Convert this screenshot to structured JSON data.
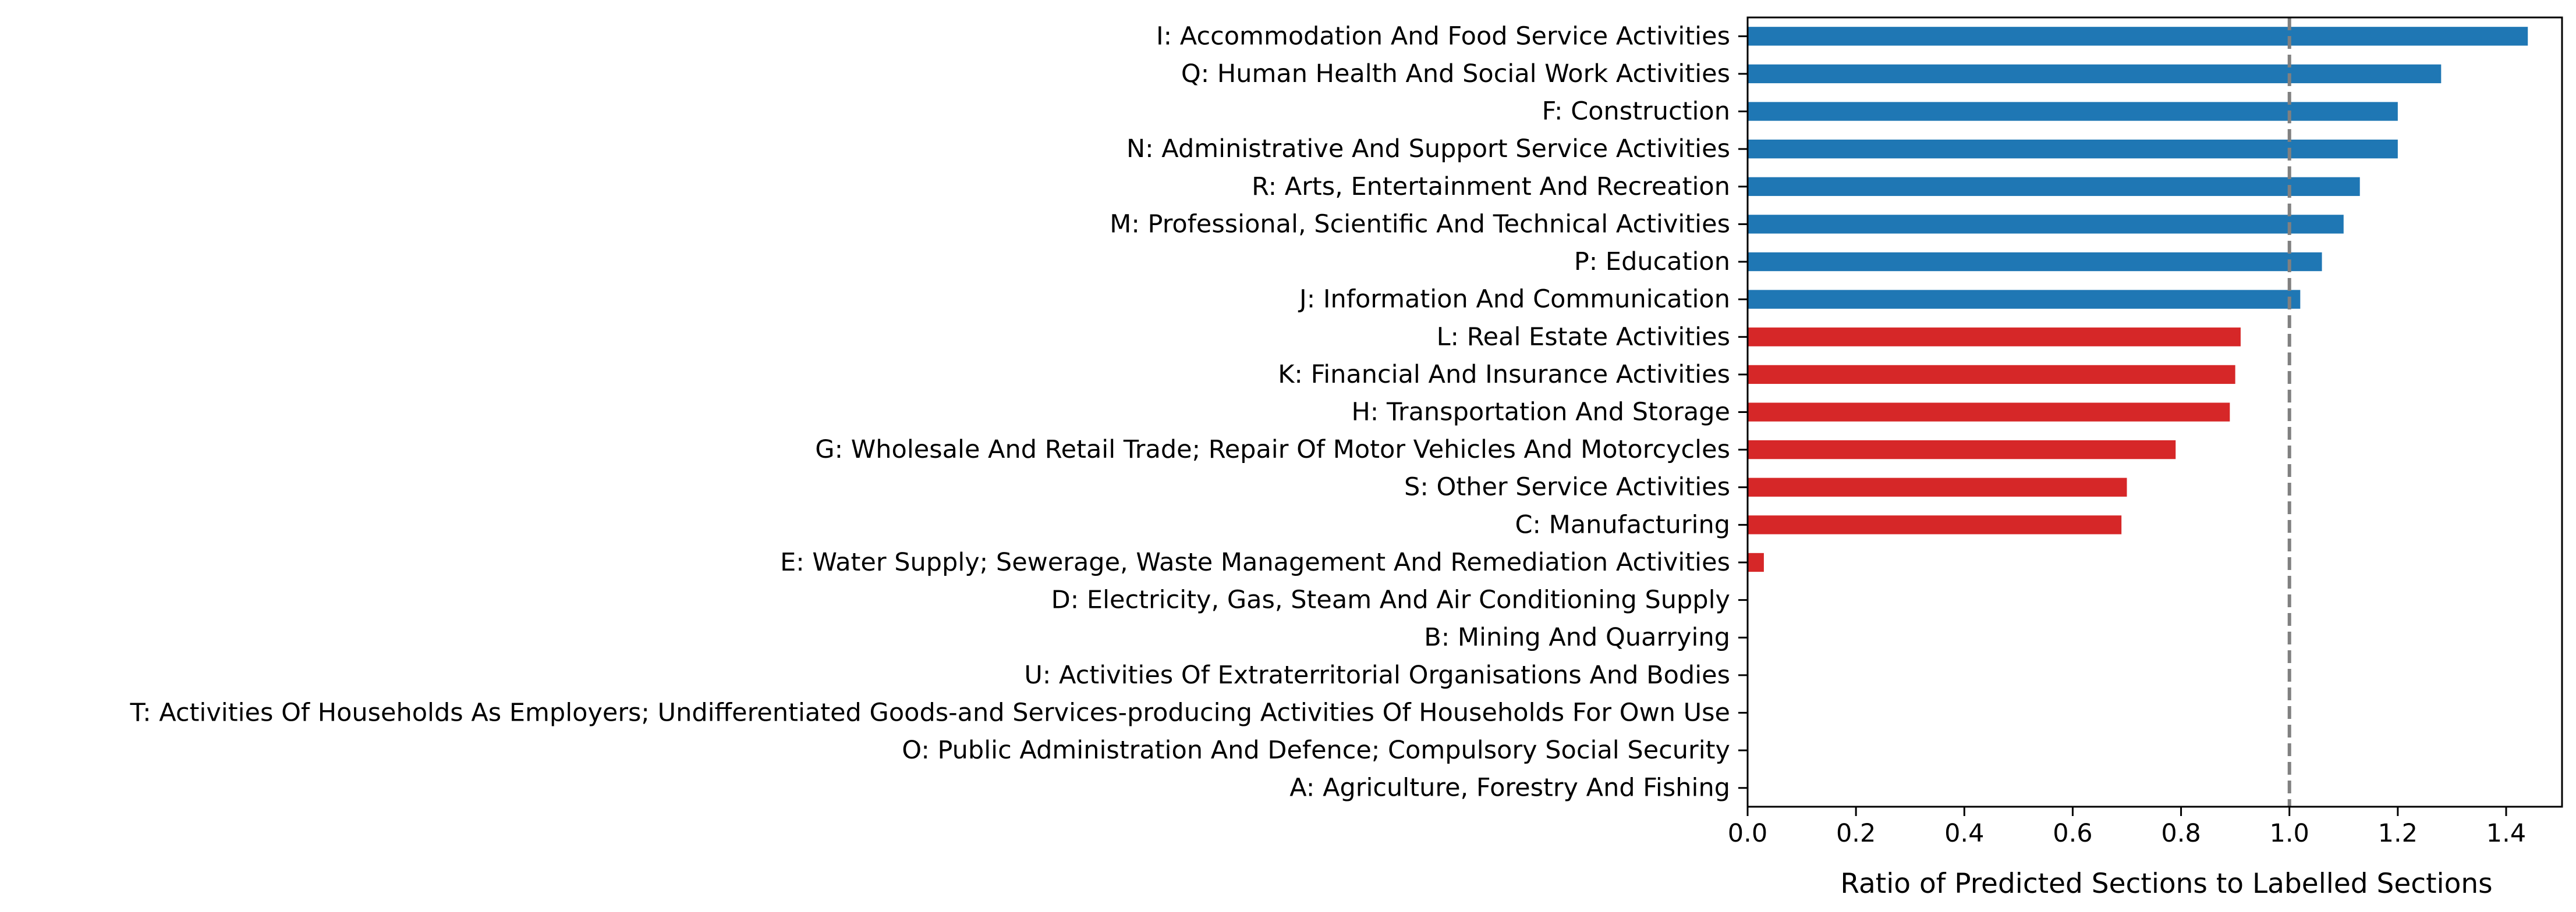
{
  "chart_data": {
    "type": "bar",
    "orientation": "horizontal",
    "title": "",
    "xlabel": "Ratio of Predicted Sections to Labelled Sections",
    "ylabel": "",
    "xlim": [
      0.0,
      1.51
    ],
    "xticks": [
      "0.0",
      "0.2",
      "0.4",
      "0.6",
      "0.8",
      "1.0",
      "1.2",
      "1.4"
    ],
    "reference_line": {
      "x": 1.0,
      "style": "dashed",
      "color": "#808080"
    },
    "colors": {
      "above_one": "#1f77b4",
      "below_one": "#d62728"
    },
    "grid": false,
    "categories": [
      "I: Accommodation And Food Service Activities",
      "Q: Human Health And Social Work Activities",
      "F: Construction",
      "N: Administrative And Support Service Activities",
      "R: Arts, Entertainment And Recreation",
      "M: Professional, Scientific And Technical Activities",
      "P: Education",
      "J: Information And Communication",
      "L: Real Estate Activities",
      "K: Financial And Insurance Activities",
      "H: Transportation And Storage",
      "G: Wholesale And Retail Trade; Repair Of Motor Vehicles And Motorcycles",
      "S: Other Service Activities",
      "C: Manufacturing",
      "E: Water Supply; Sewerage, Waste Management And Remediation Activities",
      "D: Electricity, Gas, Steam And Air Conditioning Supply",
      "B: Mining And Quarrying",
      "U: Activities Of Extraterritorial Organisations And Bodies",
      "T: Activities Of Households As Employers; Undifferentiated Goods-and Services-producing Activities Of Households For Own Use",
      "O: Public Administration And Defence; Compulsory Social Security",
      "A: Agriculture, Forestry And Fishing"
    ],
    "values": [
      1.44,
      1.28,
      1.2,
      1.2,
      1.13,
      1.1,
      1.06,
      1.02,
      0.91,
      0.9,
      0.89,
      0.79,
      0.7,
      0.69,
      0.03,
      0.0,
      0.0,
      0.0,
      0.0,
      0.0,
      0.0
    ]
  }
}
